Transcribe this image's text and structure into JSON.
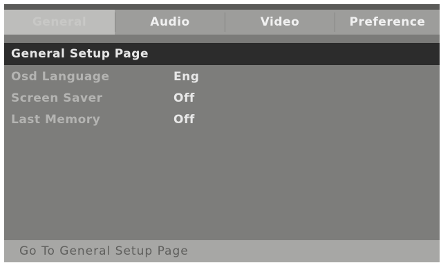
{
  "tabs": [
    {
      "label": "General",
      "active": true
    },
    {
      "label": "Audio",
      "active": false
    },
    {
      "label": "Video",
      "active": false
    },
    {
      "label": "Preference",
      "active": false
    }
  ],
  "page": {
    "title": "General Setup Page"
  },
  "settings": [
    {
      "label": "Osd Language",
      "value": "Eng"
    },
    {
      "label": "Screen Saver",
      "value": "Off"
    },
    {
      "label": "Last Memory",
      "value": "Off"
    }
  ],
  "footer": {
    "hint": "Go To General Setup Page"
  },
  "colors": {
    "panel": "#7d7d7b",
    "tabbar": "#9d9d9b",
    "active_tab": "#bdbdbb",
    "header": "#2c2c2c",
    "footer": "#a7a7a5"
  }
}
